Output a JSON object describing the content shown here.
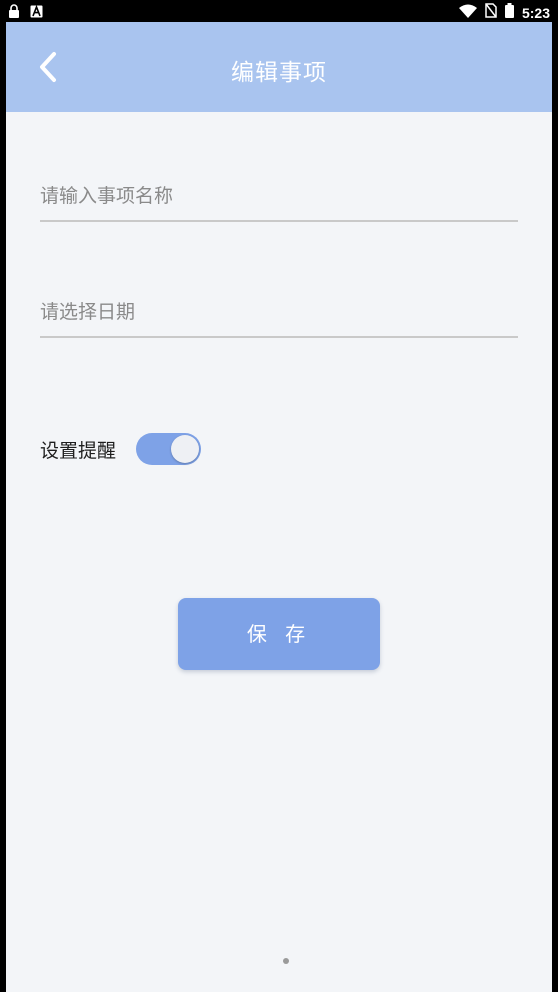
{
  "status_bar": {
    "time": "5:23",
    "left_icons": [
      "lock-icon",
      "keyboard-a-icon"
    ],
    "right_icons": [
      "wifi-icon",
      "no-sim-icon",
      "battery-icon"
    ]
  },
  "header": {
    "title": "编辑事项",
    "back_icon": "back-arrow-icon",
    "background_color": "#a9c4ef"
  },
  "form": {
    "name_placeholder": "请输入事项名称",
    "name_value": "",
    "date_placeholder": "请选择日期",
    "date_value": "",
    "reminder_label": "设置提醒",
    "reminder_enabled": true,
    "save_label": "保 存"
  },
  "colors": {
    "accent": "#7ea2e7",
    "background": "#f3f5f8"
  },
  "page_indicator": {
    "current": 1,
    "total": 1
  }
}
